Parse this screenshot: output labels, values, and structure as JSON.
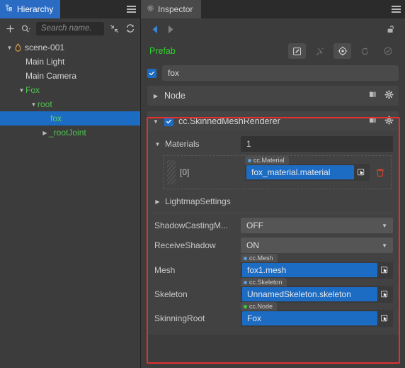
{
  "hierarchy": {
    "tab_label": "Hierarchy",
    "tab_icon": "hierarchy-icon",
    "menu_icon": "hamburger-icon",
    "toolbar": {
      "add_label": "+",
      "search_filter_icon": "search-filter-icon",
      "search_placeholder": "Search name.",
      "search_value": "",
      "collapse_icon": "collapse-all-icon",
      "sync_icon": "sync-icon"
    },
    "tree": [
      {
        "label": "scene-001",
        "depth": 0,
        "arrow": "down",
        "icon": "scene-icon",
        "color": "normal",
        "selected": false
      },
      {
        "label": "Main Light",
        "depth": 1,
        "arrow": "none",
        "icon": "",
        "color": "normal",
        "selected": false
      },
      {
        "label": "Main Camera",
        "depth": 1,
        "arrow": "none",
        "icon": "",
        "color": "normal",
        "selected": false
      },
      {
        "label": "Fox",
        "depth": 1,
        "arrow": "down",
        "icon": "",
        "color": "green",
        "selected": false
      },
      {
        "label": "root",
        "depth": 2,
        "arrow": "down",
        "icon": "",
        "color": "green",
        "selected": false
      },
      {
        "label": "fox",
        "depth": 3,
        "arrow": "none",
        "icon": "",
        "color": "green",
        "selected": true
      },
      {
        "label": "_rootJoint",
        "depth": 3,
        "arrow": "right",
        "icon": "",
        "color": "green",
        "selected": false
      }
    ]
  },
  "inspector": {
    "tab_label": "Inspector",
    "tab_icon": "gear-icon",
    "menu_icon": "hamburger-icon",
    "nav": {
      "back_icon": "arrow-left-icon",
      "forward_icon": "arrow-right-icon",
      "lock_icon": "unlock-icon"
    },
    "prefab": {
      "label": "Prefab",
      "buttons": [
        {
          "name": "edit-prefab-button",
          "icon": "edit-square-icon",
          "enabled": true
        },
        {
          "name": "unlink-prefab-button",
          "icon": "unlink-icon",
          "enabled": false
        },
        {
          "name": "locate-prefab-button",
          "icon": "locate-target-icon",
          "enabled": true
        },
        {
          "name": "revert-prefab-button",
          "icon": "refresh-icon",
          "enabled": false
        },
        {
          "name": "apply-prefab-button",
          "icon": "check-circle-icon",
          "enabled": false
        }
      ]
    },
    "node": {
      "enabled": true,
      "name_value": "fox",
      "section_label": "Node",
      "section_expanded": false,
      "help_icon": "book-icon",
      "settings_icon": "gear-icon"
    },
    "component": {
      "enabled": true,
      "title": "cc.SkinnedMeshRenderer",
      "expanded": true,
      "help_icon": "book-icon",
      "settings_icon": "gear-icon",
      "materials": {
        "label": "Materials",
        "expanded": true,
        "count": "1",
        "elements": [
          {
            "index_label": "[0]",
            "type_label": "cc.Material",
            "value": "fox_material.material",
            "pick_icon": "pick-asset-icon",
            "delete_icon": "trash-icon"
          }
        ]
      },
      "lightmap_settings": {
        "label": "LightmapSettings",
        "expanded": false
      },
      "shadow_casting": {
        "label": "ShadowCastingM...",
        "value": "OFF"
      },
      "receive_shadow": {
        "label": "ReceiveShadow",
        "value": "ON"
      },
      "mesh": {
        "label": "Mesh",
        "type_label": "cc.Mesh",
        "value": "fox1.mesh",
        "pick_icon": "pick-asset-icon"
      },
      "skeleton": {
        "label": "Skeleton",
        "type_label": "cc.Skeleton",
        "value": "UnnamedSkeleton.skeleton",
        "pick_icon": "pick-asset-icon"
      },
      "skinning_root": {
        "label": "SkinningRoot",
        "type_label": "cc.Node",
        "value": "Fox",
        "pick_icon": "pick-asset-icon"
      }
    }
  },
  "colors": {
    "accent_blue": "#1d6cc4",
    "tab_active_blue": "#2a6bc4",
    "prefab_green": "#2fd02f",
    "tree_green": "#4fc14f",
    "highlight_red": "#e03030",
    "trash_red": "#d9452f",
    "panel_bg": "#3c3c3c"
  }
}
